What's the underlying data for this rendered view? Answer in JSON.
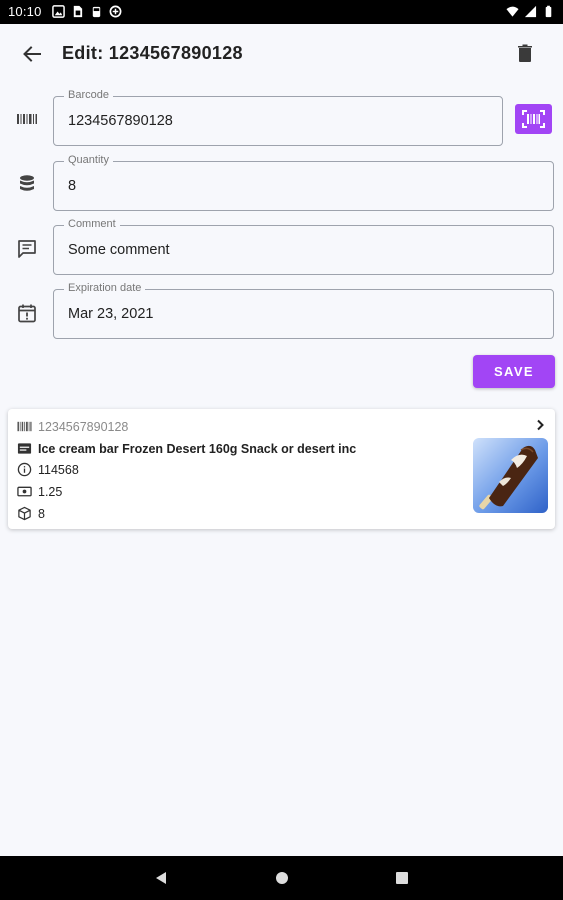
{
  "status_bar": {
    "time": "10:10"
  },
  "app_bar": {
    "title": "Edit: 1234567890128"
  },
  "form": {
    "barcode": {
      "label": "Barcode",
      "value": "1234567890128"
    },
    "quantity": {
      "label": "Quantity",
      "value": "8"
    },
    "comment": {
      "label": "Comment",
      "value": "Some comment"
    },
    "expiration": {
      "label": "Expiration date",
      "value": "Mar 23, 2021"
    },
    "save_label": "SAVE"
  },
  "product_card": {
    "barcode": "1234567890128",
    "name": "Ice cream bar Frozen Desert 160g Snack or desert inc",
    "code": "114568",
    "price": "1.25",
    "quantity": "8"
  },
  "colors": {
    "accent": "#a245f5",
    "background": "#f7f8fc"
  },
  "icons": {
    "status": [
      "gallery-icon",
      "sim-card-icon",
      "android-icon",
      "data-saver-icon",
      "wifi-icon",
      "signal-icon",
      "battery-icon"
    ],
    "form": [
      "barcode-icon",
      "database-icon",
      "comment-icon",
      "calendar-alert-icon",
      "barcode-scan-icon"
    ],
    "card": [
      "barcode-icon",
      "card-name-icon",
      "info-icon",
      "money-icon",
      "box-icon",
      "chevron-right-icon"
    ]
  }
}
